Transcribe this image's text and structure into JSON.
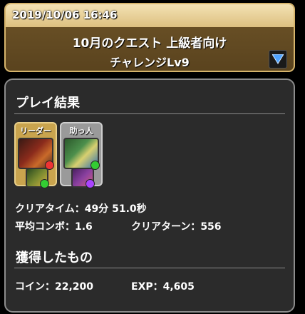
{
  "header": {
    "date": "2019/10/06 16:46",
    "title": "10月のクエスト 上級者向け",
    "subtitle": "チャレンジLv9",
    "dropdown_icon": "triangle-down-icon",
    "accent_color": "#d6b46c"
  },
  "result": {
    "heading": "プレイ結果",
    "leader_label": "リーダー",
    "helper_label": "助っ人",
    "clear_time_label": "クリアタイム：",
    "clear_time_value": "49分 51.0秒",
    "avg_combo_label": "平均コンボ：",
    "avg_combo_value": "1.6",
    "clear_turns_label": "クリアターン：",
    "clear_turns_value": "556"
  },
  "rewards": {
    "heading": "獲得したもの",
    "coin_label": "コイン：",
    "coin_value": "22,200",
    "exp_label": "EXP：",
    "exp_value": "4,605"
  }
}
